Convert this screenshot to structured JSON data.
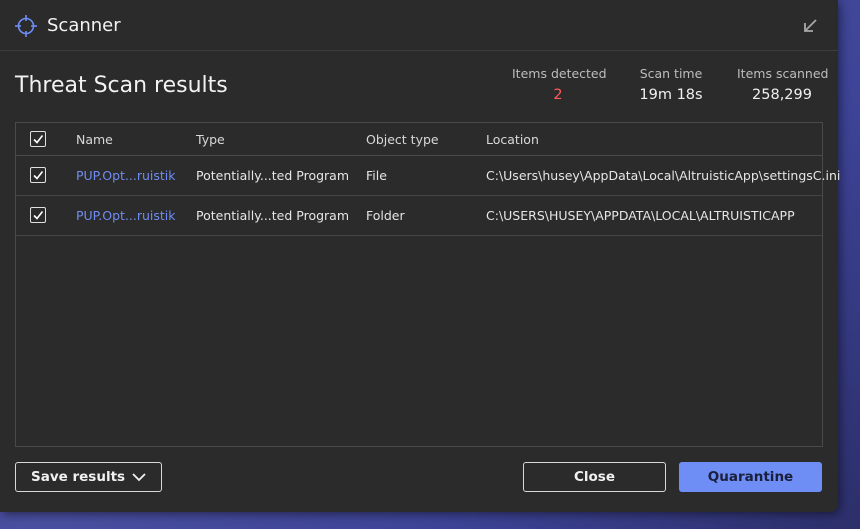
{
  "window": {
    "title": "Scanner"
  },
  "header": {
    "title": "Threat Scan results"
  },
  "stats": [
    {
      "label": "Items detected",
      "value": "2",
      "color": "#ff5a5a"
    },
    {
      "label": "Scan time",
      "value": "19m 18s"
    },
    {
      "label": "Items scanned",
      "value": "258,299"
    }
  ],
  "table": {
    "columns": [
      "Name",
      "Type",
      "Object type",
      "Location"
    ],
    "rows": [
      {
        "checked": true,
        "name": "PUP.Opt...ruistik",
        "type": "Potentially...ted Program",
        "object_type": "File",
        "location": "C:\\Users\\husey\\AppData\\Local\\AltruisticApp\\settingsC.ini"
      },
      {
        "checked": true,
        "name": "PUP.Opt...ruistik",
        "type": "Potentially...ted Program",
        "object_type": "Folder",
        "location": "C:\\USERS\\HUSEY\\APPDATA\\LOCAL\\ALTRUISTICAPP"
      }
    ]
  },
  "footer": {
    "save_label": "Save results",
    "close_label": "Close",
    "quarantine_label": "Quarantine"
  },
  "icons": {
    "app": "crosshair-icon",
    "minimize": "arrow-down-left-icon",
    "checkbox": "checkmark-icon",
    "dropdown": "chevron-down-icon"
  },
  "colors": {
    "accent": "#6e8df5",
    "link": "#6f8cf0",
    "detected": "#ff5a5a",
    "window_bg": "#2b2b2b"
  }
}
